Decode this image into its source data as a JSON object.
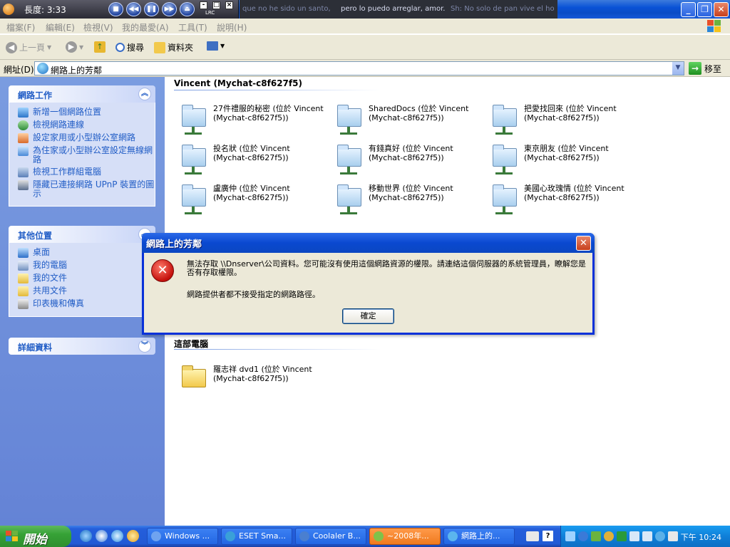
{
  "window": {
    "player_length": "長度: 3:33",
    "lrc_label": "LRC",
    "lyrics": [
      {
        "text": "que no he sido un santo,",
        "color": "#7d86a8"
      },
      {
        "text": "pero lo puedo arreglar, amor.",
        "color": "#d8dcf0"
      },
      {
        "text": "Sh: No solo de pan vive el ho",
        "color": "#7d86a8"
      }
    ],
    "minimize": "_",
    "maximize": "❐",
    "close": "✕"
  },
  "menu": {
    "items": [
      "檔案(F)",
      "編輯(E)",
      "檢視(V)",
      "我的最愛(A)",
      "工具(T)",
      "說明(H)"
    ]
  },
  "toolbar": {
    "back": "上一頁",
    "search": "搜尋",
    "folders": "資料夾"
  },
  "address": {
    "label": "網址(D)",
    "value": "網路上的芳鄰",
    "go": "移至"
  },
  "sidebar": {
    "network_tasks": {
      "title": "網路工作",
      "items": [
        "新增一個網路位置",
        "檢視網路連線",
        "設定家用或小型辦公室網路",
        "為住家或小型辦公室設定無線網路",
        "檢視工作群組電腦",
        "隱藏已連接網路 UPnP 裝置的圖示"
      ]
    },
    "other_places": {
      "title": "其他位置",
      "items": [
        "桌面",
        "我的電腦",
        "我的文件",
        "共用文件",
        "印表機和傳真"
      ]
    },
    "details": {
      "title": "詳細資料"
    }
  },
  "content": {
    "group1_title": "Vincent (Mychat-c8f627f5)",
    "shares": [
      {
        "name": "27件禮服的秘密 (位於 Vincent",
        "host": "(Mychat-c8f627f5))"
      },
      {
        "name": "SharedDocs (位於 Vincent",
        "host": "(Mychat-c8f627f5))"
      },
      {
        "name": "把愛找回來 (位於 Vincent",
        "host": "(Mychat-c8f627f5))"
      },
      {
        "name": "投名狀 (位於 Vincent",
        "host": "(Mychat-c8f627f5))"
      },
      {
        "name": "有錢真好 (位於 Vincent",
        "host": "(Mychat-c8f627f5))"
      },
      {
        "name": "東京朋友 (位於 Vincent",
        "host": "(Mychat-c8f627f5))"
      },
      {
        "name": "盧廣仲 (位於 Vincent",
        "host": "(Mychat-c8f627f5))"
      },
      {
        "name": "移動世界 (位於 Vincent",
        "host": "(Mychat-c8f627f5))"
      },
      {
        "name": "美國心玫瑰情 (位於 Vincent",
        "host": "(Mychat-c8f627f5))"
      }
    ],
    "group2_title": "這部電腦",
    "local": {
      "name": "羅志祥 dvd1 (位於 Vincent",
      "host": "(Mychat-c8f627f5))"
    }
  },
  "dialog": {
    "title": "網路上的芳鄰",
    "close": "✕",
    "message1": "無法存取 \\\\Dnserver\\公司資料。您可能沒有使用這個網路資源的權限。請連絡這個伺服器的系統管理員，瞭解您是否有存取權限。",
    "message2": "網路提供者都不接受指定的網路路徑。",
    "ok": "確定"
  },
  "taskbar": {
    "start": "開始",
    "buttons": [
      {
        "label": "Windows ...",
        "color": "#6fa3f0"
      },
      {
        "label": "ESET Sma...",
        "color": "#3aa0d8"
      },
      {
        "label": "Coolaler B...",
        "color": "#4a7fd0"
      },
      {
        "label": "~2008年...",
        "color": "#7fc24a"
      },
      {
        "label": "網路上的...",
        "color": "#5bb5ee"
      }
    ],
    "clock": "下午 10:24"
  },
  "colors": {
    "accent": "#215dc6",
    "title_blue": "#0a52d6",
    "sidebar_blue": "#7a9ce0",
    "start_green": "#36a236",
    "active_task": "#f07a1e",
    "error_red": "#c4100c"
  }
}
